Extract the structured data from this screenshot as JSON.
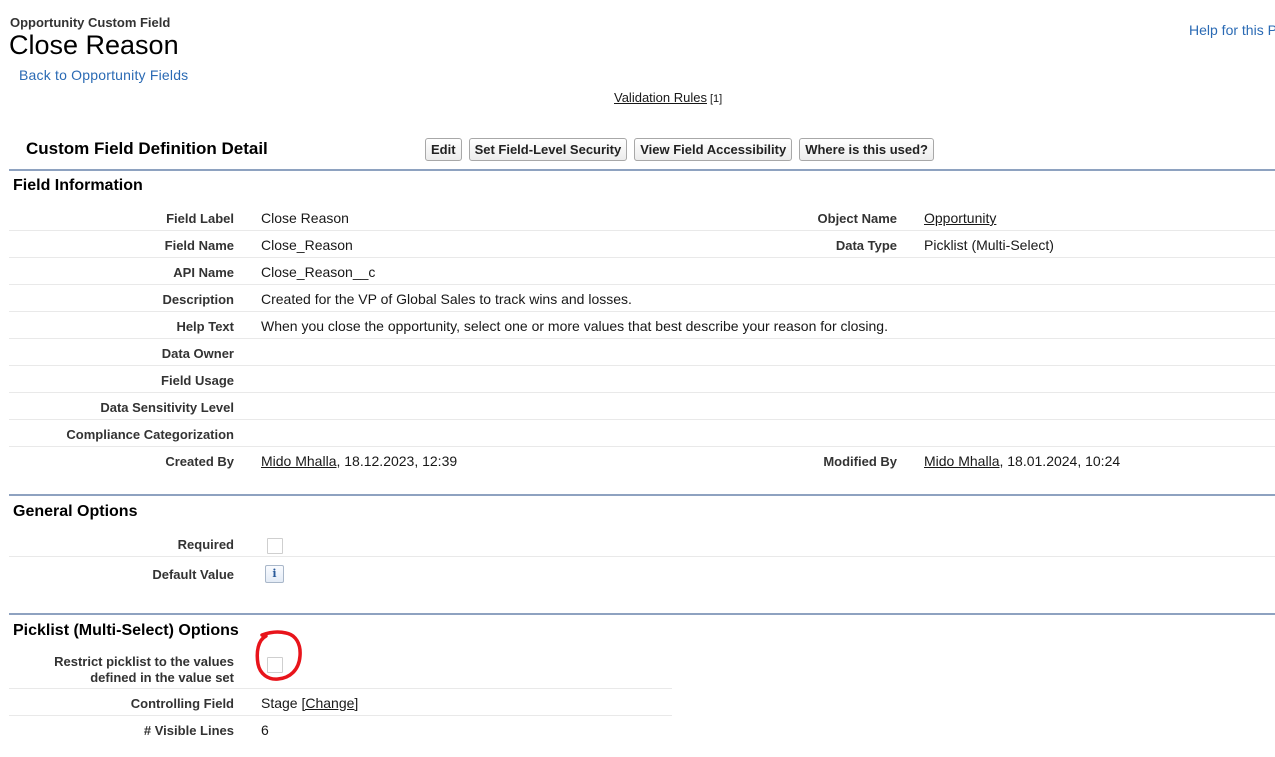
{
  "header": {
    "object_type": "Opportunity Custom Field",
    "title": "Close Reason",
    "back_link": "Back to Opportunity Fields",
    "help_link": "Help for this P"
  },
  "related": {
    "validation_rules_label": "Validation Rules",
    "validation_rules_count": "[1]"
  },
  "detail": {
    "title": "Custom Field Definition Detail",
    "buttons": {
      "edit": "Edit",
      "fls": "Set Field-Level Security",
      "accessibility": "View Field Accessibility",
      "where_used": "Where is this used?"
    }
  },
  "field_info": {
    "heading": "Field Information",
    "field_label_lbl": "Field Label",
    "field_label_val": "Close Reason",
    "object_name_lbl": "Object Name",
    "object_name_val": "Opportunity",
    "field_name_lbl": "Field Name",
    "field_name_val": "Close_Reason",
    "data_type_lbl": "Data Type",
    "data_type_val": "Picklist (Multi-Select)",
    "api_name_lbl": "API Name",
    "api_name_val": "Close_Reason__c",
    "description_lbl": "Description",
    "description_val": "Created for the VP of Global Sales to track wins and losses.",
    "help_text_lbl": "Help Text",
    "help_text_val": "When you close the opportunity, select one or more values that best describe your reason for closing.",
    "data_owner_lbl": "Data Owner",
    "field_usage_lbl": "Field Usage",
    "sensitivity_lbl": "Data Sensitivity Level",
    "compliance_lbl": "Compliance Categorization",
    "created_by_lbl": "Created By",
    "created_by_user": "Mido Mhalla",
    "created_by_date": ", 18.12.2023, 12:39",
    "modified_by_lbl": "Modified By",
    "modified_by_user": "Mido Mhalla",
    "modified_by_date": ", 18.01.2024, 10:24"
  },
  "general_options": {
    "heading": "General Options",
    "required_lbl": "Required",
    "required_checked": false,
    "default_value_lbl": "Default Value",
    "info_icon_glyph": "i"
  },
  "picklist_options": {
    "heading": "Picklist (Multi-Select) Options",
    "restrict_lbl_line1": "Restrict picklist to the values",
    "restrict_lbl_line2": "defined in the value set",
    "restrict_checked": false,
    "controlling_field_lbl": "Controlling Field",
    "controlling_field_val": "Stage",
    "change_link": "[Change]",
    "visible_lines_lbl": "# Visible Lines",
    "visible_lines_val": "6"
  },
  "annotation": {
    "color": "#e8141b"
  }
}
